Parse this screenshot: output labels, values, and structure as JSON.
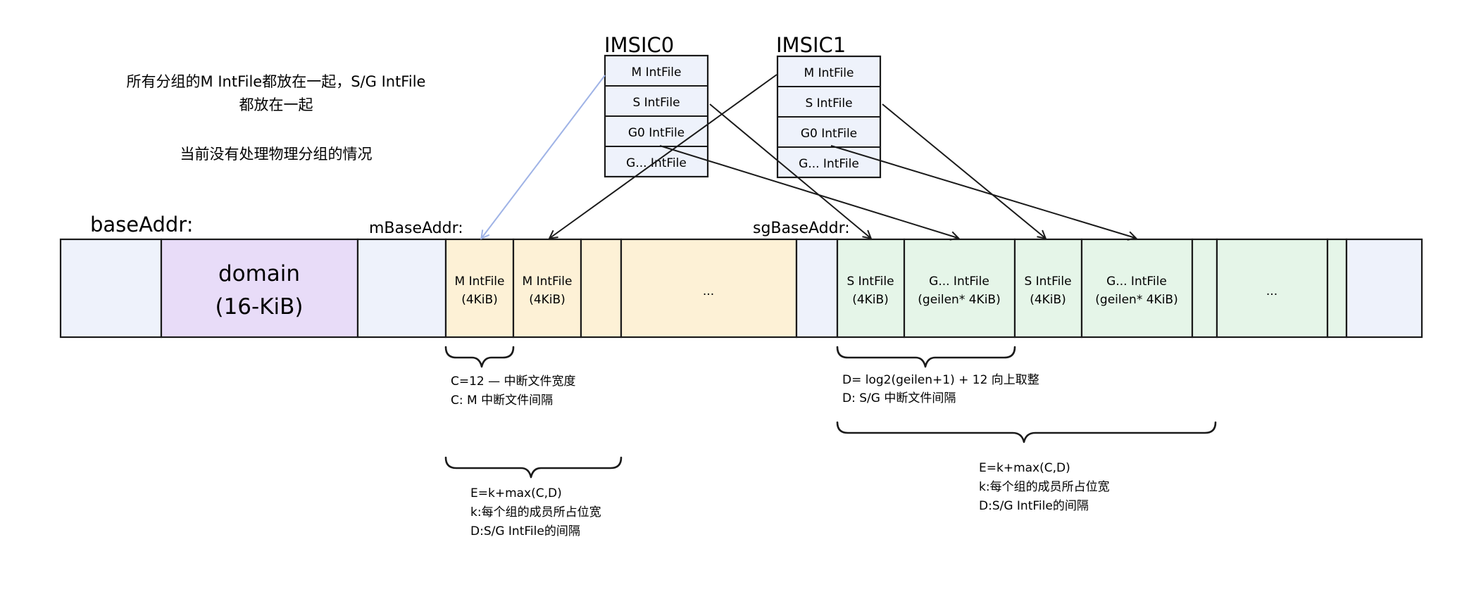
{
  "notes": {
    "line1": "所有分组的M IntFile都放在一起，S/G IntFile",
    "line2": "都放在一起",
    "line3": "当前没有处理物理分组的情况"
  },
  "labels": {
    "base_addr": "baseAddr:",
    "m_base_addr": "mBaseAddr:",
    "sg_base_addr": "sgBaseAddr:"
  },
  "imsics": [
    {
      "title": "IMSIC0",
      "files": [
        "M IntFile",
        "S IntFile",
        "G0 IntFile",
        "G... IntFile"
      ]
    },
    {
      "title": "IMSIC1",
      "files": [
        "M IntFile",
        "S IntFile",
        "G0 IntFile",
        "G... IntFile"
      ]
    }
  ],
  "memory": {
    "domain_line1": "domain",
    "domain_line2": "(16-KiB)",
    "m_blocks": [
      {
        "line1": "M IntFile",
        "line2": "(4KiB)"
      },
      {
        "line1": "M IntFile",
        "line2": "(4KiB)"
      }
    ],
    "m_ellipsis": "...",
    "sg_blocks": [
      {
        "line1": "S IntFile",
        "line2": "(4KiB)"
      },
      {
        "line1": "G... IntFile",
        "line2": "(geilen* 4KiB)"
      },
      {
        "line1": "S IntFile",
        "line2": "(4KiB)"
      },
      {
        "line1": "G... IntFile",
        "line2": "(geilen* 4KiB)"
      }
    ],
    "sg_ellipsis": "..."
  },
  "annotations": {
    "c1": "C=12 — 中断文件宽度",
    "c2": "C: M 中断文件间隔",
    "d1": "D= log2(geilen+1) + 12 向上取整",
    "d2": "D: S/G 中断文件间隔",
    "em1": "E=k+max(C,D)",
    "em2": "k:每个组的成员所占位宽",
    "em3": "D:S/G IntFile的间隔",
    "es1": "E=k+max(C,D)",
    "es2": "k:每个组的成员所占位宽",
    "es3": "D:S/G IntFile的间隔"
  },
  "colors": {
    "light_blue": "#eef2fb",
    "domain_purple": "#e8dcf8",
    "m_yellow": "#fdf1d6",
    "sg_green": "#e5f5e8",
    "stroke": "#1a1a1a",
    "blue_arrow": "#9fb3e6"
  }
}
